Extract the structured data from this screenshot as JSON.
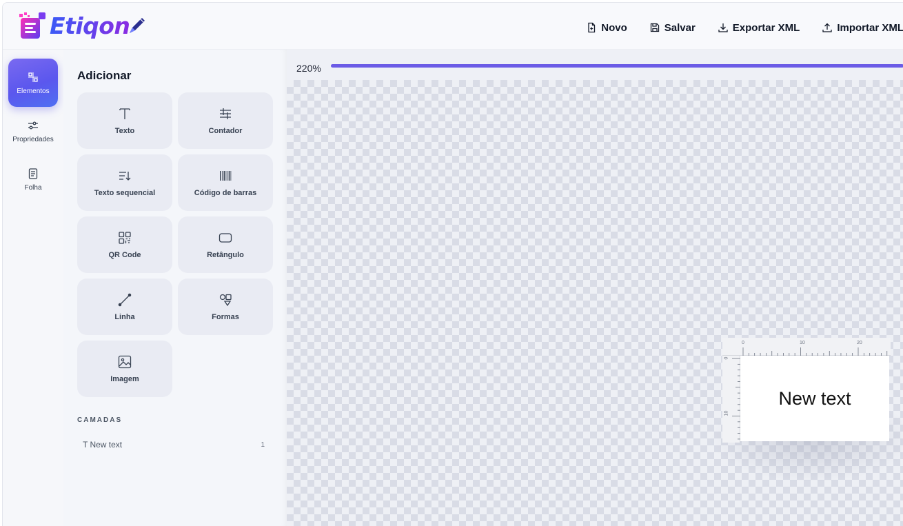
{
  "app": {
    "name": "Etiqon",
    "brand_colors": {
      "primary": "#5b3df0",
      "accent": "#3b5bf6",
      "logo_pink": "#e020c8"
    }
  },
  "header": {
    "actions": [
      {
        "label": "Novo",
        "icon": "file-plus-icon"
      },
      {
        "label": "Salvar",
        "icon": "save-icon"
      },
      {
        "label": "Exportar XML",
        "icon": "download-icon"
      },
      {
        "label": "Importar XML",
        "icon": "upload-icon"
      }
    ]
  },
  "rail": {
    "items": [
      {
        "label": "Elementos",
        "icon": "elements-icon",
        "active": true
      },
      {
        "label": "Propriedades",
        "icon": "sliders-icon",
        "active": false
      },
      {
        "label": "Folha",
        "icon": "sheet-icon",
        "active": false
      }
    ]
  },
  "panel": {
    "title": "Adicionar",
    "tiles": [
      {
        "label": "Texto",
        "icon": "text-icon"
      },
      {
        "label": "Contador",
        "icon": "counter-icon"
      },
      {
        "label": "Texto sequencial",
        "icon": "sequential-text-icon"
      },
      {
        "label": "Código de barras",
        "icon": "barcode-icon"
      },
      {
        "label": "QR Code",
        "icon": "qr-code-icon"
      },
      {
        "label": "Retângulo",
        "icon": "rectangle-icon"
      },
      {
        "label": "Linha",
        "icon": "line-icon"
      },
      {
        "label": "Formas",
        "icon": "shapes-icon"
      },
      {
        "label": "Imagem",
        "icon": "image-icon"
      }
    ],
    "layers_title": "CAMADAS",
    "layers": [
      {
        "label": "T New text",
        "count": "1"
      }
    ]
  },
  "canvas": {
    "zoom_label": "220%",
    "zoom_fraction": 1.0,
    "label_text": "New text",
    "ruler_top_marks": [
      "0",
      "10",
      "20"
    ],
    "ruler_left_marks": [
      "0",
      "10"
    ]
  }
}
